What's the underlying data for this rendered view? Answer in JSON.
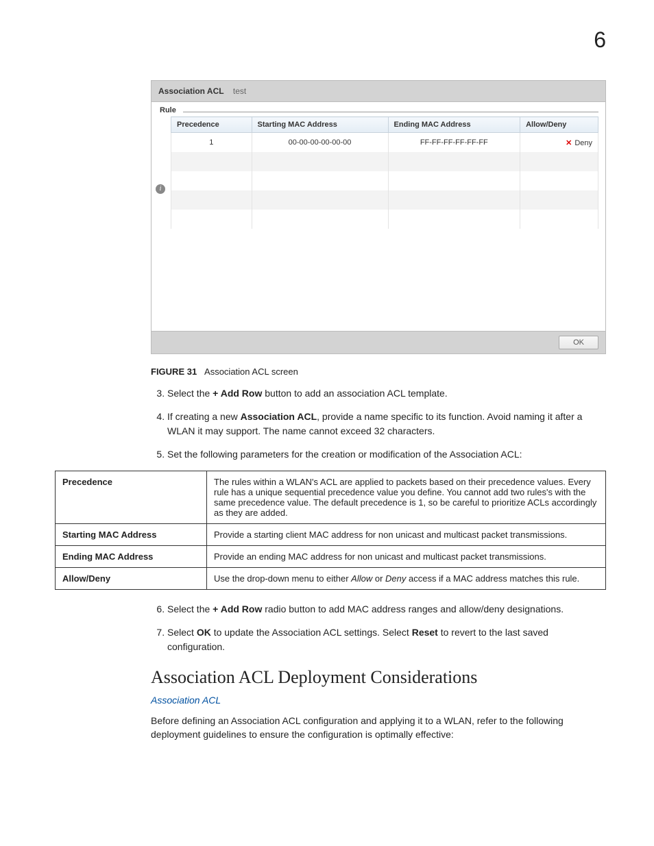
{
  "page_number": "6",
  "acl_panel": {
    "title_bold": "Association ACL",
    "title_name": "test",
    "rule_legend": "Rule",
    "headers": {
      "precedence": "Precedence",
      "starting": "Starting MAC Address",
      "ending": "Ending MAC Address",
      "allowdeny": "Allow/Deny"
    },
    "rows": [
      {
        "precedence": "1",
        "starting": "00-00-00-00-00-00",
        "ending": "FF-FF-FF-FF-FF-FF",
        "allowdeny": "Deny"
      }
    ],
    "ok": "OK"
  },
  "figure": {
    "label": "FIGURE 31",
    "caption": "Association ACL screen"
  },
  "steps_a": {
    "s3_pre": "Select the ",
    "s3_bold": "+ Add Row",
    "s3_post": " button to add an association ACL template.",
    "s4_pre": "If creating a new ",
    "s4_bold": "Association ACL",
    "s4_post": ", provide a name specific to its function. Avoid naming it after a WLAN it may support. The name cannot exceed 32 characters.",
    "s5": "Set the following parameters for the creation or modification of the Association ACL:"
  },
  "param_table": {
    "r1": {
      "key": "Precedence",
      "val": "The rules within a WLAN's ACL are applied to packets based on their precedence values. Every rule has a unique sequential precedence value you define. You cannot add two rules's with the same precedence value. The default precedence is 1, so be careful to prioritize ACLs accordingly as they are added."
    },
    "r2": {
      "key": "Starting MAC Address",
      "val": "Provide a starting client MAC address for non unicast and multicast packet transmissions."
    },
    "r3": {
      "key": "Ending MAC Address",
      "val": "Provide an ending MAC address for non unicast and multicast packet transmissions."
    },
    "r4": {
      "key": "Allow/Deny",
      "val_pre": "Use the drop-down menu to either ",
      "val_i1": "Allow",
      "val_mid": " or ",
      "val_i2": "Deny",
      "val_post": " access if a MAC address matches this rule."
    }
  },
  "steps_b": {
    "s6_pre": "Select the ",
    "s6_bold": "+ Add Row",
    "s6_post": " radio button to add MAC address ranges and allow/deny designations.",
    "s7_pre": "Select ",
    "s7_b1": "OK",
    "s7_mid": " to update the Association ACL settings. Select ",
    "s7_b2": "Reset",
    "s7_post": " to revert to the last saved configuration."
  },
  "section_heading": "Association ACL Deployment Considerations",
  "section_link": "Association ACL",
  "section_para": "Before defining an Association ACL configuration and applying it to a WLAN, refer to the following deployment guidelines to ensure the configuration is optimally effective:"
}
